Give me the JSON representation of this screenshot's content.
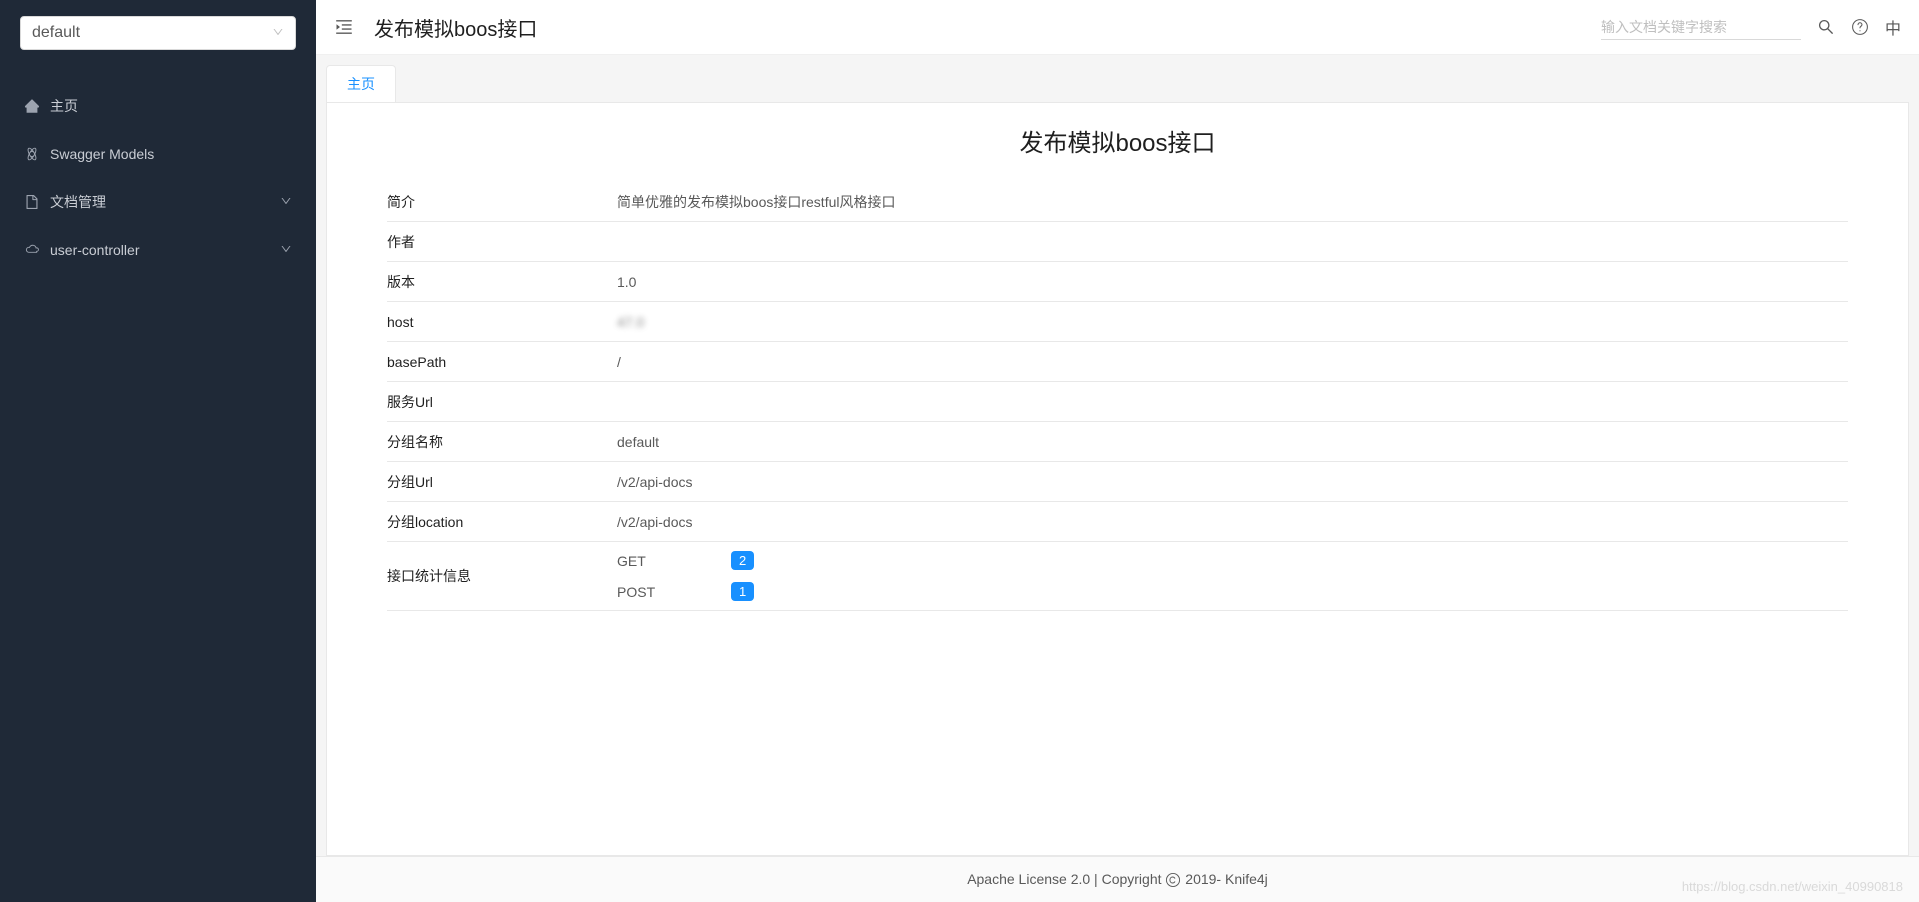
{
  "sidebar": {
    "select_value": "default",
    "items": [
      {
        "label": "主页",
        "icon": "home",
        "expandable": false
      },
      {
        "label": "Swagger Models",
        "icon": "models",
        "expandable": false
      },
      {
        "label": "文档管理",
        "icon": "docs",
        "expandable": true
      },
      {
        "label": "user-controller",
        "icon": "cloud",
        "expandable": true
      }
    ]
  },
  "header": {
    "title": "发布模拟boos接口",
    "search_placeholder": "输入文档关键字搜索",
    "lang": "中"
  },
  "tabs": [
    {
      "label": "主页"
    }
  ],
  "content": {
    "title": "发布模拟boos接口",
    "rows": [
      {
        "label": "简介",
        "value": "简单优雅的发布模拟boos接口restful风格接口"
      },
      {
        "label": "作者",
        "value": ""
      },
      {
        "label": "版本",
        "value": "1.0"
      },
      {
        "label": "host",
        "value": "47.0",
        "redacted": true
      },
      {
        "label": "basePath",
        "value": "/"
      },
      {
        "label": "服务Url",
        "value": ""
      },
      {
        "label": "分组名称",
        "value": "default"
      },
      {
        "label": "分组Url",
        "value": "/v2/api-docs"
      },
      {
        "label": "分组location",
        "value": "/v2/api-docs"
      }
    ],
    "stats_label": "接口统计信息",
    "stats": [
      {
        "method": "GET",
        "count": "2"
      },
      {
        "method": "POST",
        "count": "1"
      }
    ]
  },
  "footer": {
    "text_left": "Apache License 2.0 | Copyright ",
    "text_year": " 2019-",
    "link": "Knife4j"
  },
  "watermark": "https://blog.csdn.net/weixin_40990818"
}
